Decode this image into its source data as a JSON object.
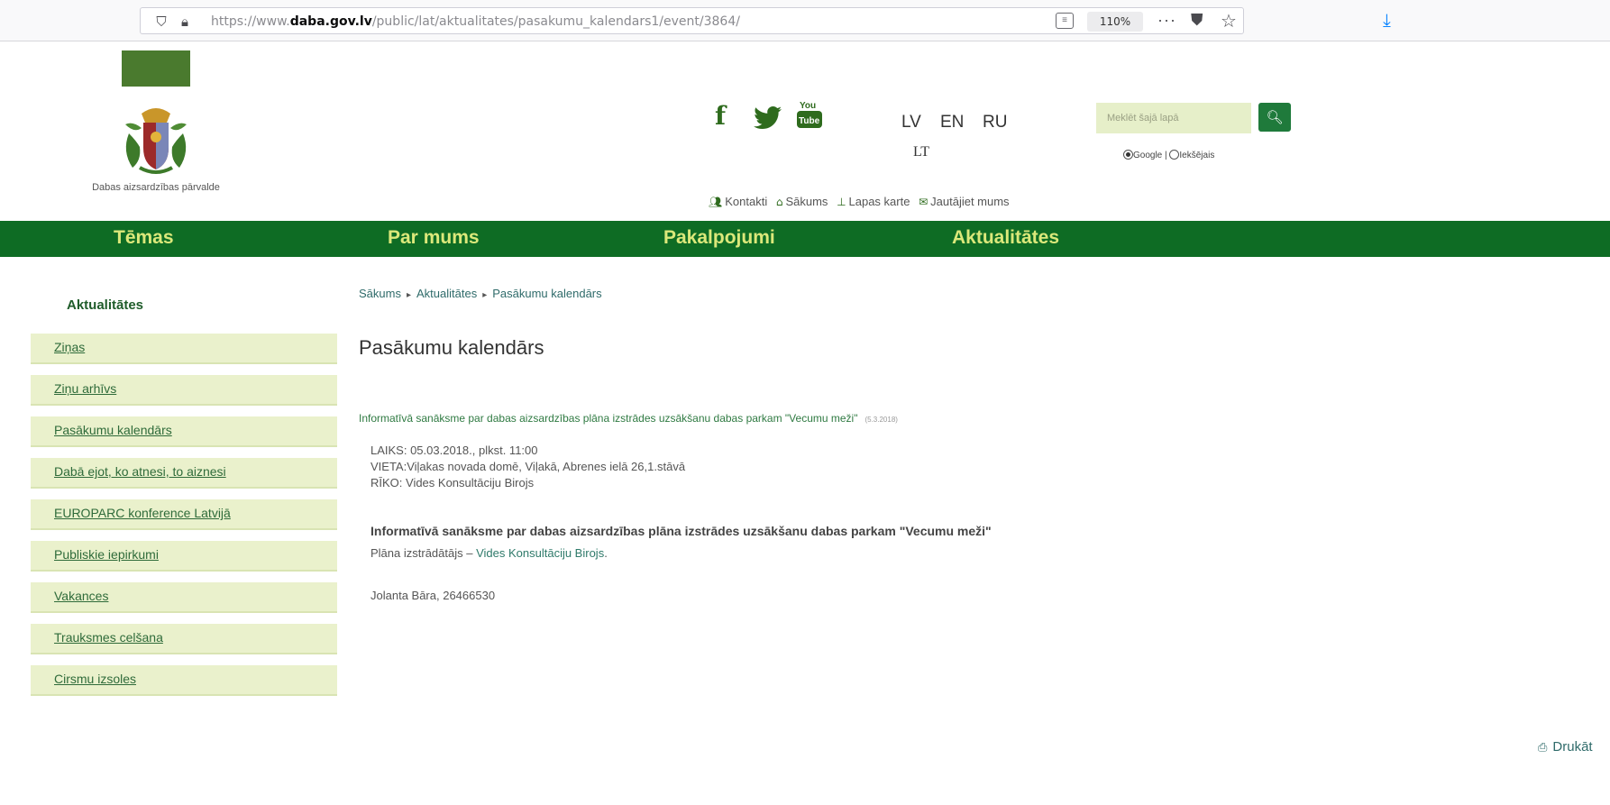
{
  "browser": {
    "url_prefix": "https://www.",
    "url_domain": "daba.gov.lv",
    "url_path": "/public/lat/aktualitates/pasakumu_kalendars1/event/3864/",
    "zoom": "110%"
  },
  "header": {
    "org_name": "Dabas aizsardzības pārvalde",
    "languages": [
      "LV",
      "EN",
      "RU",
      "LT"
    ],
    "search_placeholder": "Meklēt šajā lapā",
    "search_options": [
      "Google",
      "Iekšējais"
    ],
    "util_links": [
      "Kontakti",
      "Sākums",
      "Lapas karte",
      "Jautājiet mums"
    ]
  },
  "nav": [
    "Tēmas",
    "Par mums",
    "Pakalpojumi",
    "Aktualitātes"
  ],
  "sidebar": {
    "title": "Aktualitātes",
    "items": [
      "Ziņas",
      "Ziņu arhīvs",
      "Pasākumu kalendārs",
      "Dabā ejot, ko atnesi, to aiznesi",
      "EUROPARC konference Latvijā",
      "Publiskie iepirkumi",
      "Vakances",
      "Trauksmes celšana",
      "Cirsmu izsoles"
    ]
  },
  "content": {
    "breadcrumb": [
      "Sākums",
      "Aktualitātes",
      "Pasākumu kalendārs"
    ],
    "title": "Pasākumu kalendārs",
    "event_link": "Informatīvā sanāksme par dabas aizsardzības plāna izstrādes uzsākšanu dabas parkam \"Vecumu meži\"",
    "event_date": "(5.3.2018)",
    "body_lines": [
      "LAIKS: 05.03.2018., plkst. 11:00",
      "VIETA:Viļakas novada domē, Viļakā, Abrenes ielā 26,1.stāvā",
      "RĪKO: Vides Konsultāciju Birojs"
    ],
    "heading": "Informatīvā sanāksme par dabas aizsardzības plāna izstrādes uzsākšanu dabas parkam \"Vecumu meži\"",
    "developer_label": "Plāna izstrādātājs – ",
    "developer_link": "Vides Konsultāciju Birojs",
    "developer_end": ".",
    "contact": "Jolanta Bāra, 26466530",
    "print": "Drukāt"
  },
  "colors": {
    "nav_bg": "#0e6c24",
    "nav_text": "#dbe87a",
    "sidebar_bg": "#eaf1cc",
    "link": "#2f7a42"
  }
}
